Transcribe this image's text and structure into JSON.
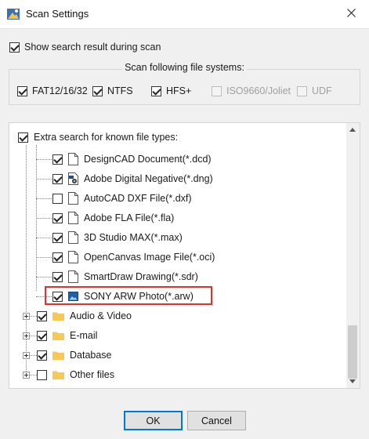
{
  "window": {
    "title": "Scan Settings"
  },
  "options": {
    "show_search_result": {
      "label": "Show search result during scan",
      "checked": true
    }
  },
  "file_systems": {
    "group_label": "Scan following file systems:",
    "items": [
      {
        "label": "FAT12/16/32",
        "checked": true,
        "enabled": true
      },
      {
        "label": "NTFS",
        "checked": true,
        "enabled": true
      },
      {
        "label": "HFS+",
        "checked": true,
        "enabled": true
      },
      {
        "label": "ISO9660/Joliet",
        "checked": false,
        "enabled": false
      },
      {
        "label": "UDF",
        "checked": false,
        "enabled": false
      }
    ]
  },
  "file_types": {
    "root_label": "Extra search for known file types:",
    "root_checked": true,
    "items": [
      {
        "label": "DesignCAD Document(*.dcd)",
        "checked": true,
        "icon": "document-icon"
      },
      {
        "label": "Adobe Digital Negative(*.dng)",
        "checked": true,
        "icon": "dng-file-icon"
      },
      {
        "label": "AutoCAD DXF File(*.dxf)",
        "checked": false,
        "icon": "document-icon"
      },
      {
        "label": "Adobe FLA File(*.fla)",
        "checked": true,
        "icon": "document-icon"
      },
      {
        "label": "3D Studio MAX(*.max)",
        "checked": true,
        "icon": "document-icon"
      },
      {
        "label": "OpenCanvas Image File(*.oci)",
        "checked": true,
        "icon": "document-icon"
      },
      {
        "label": "SmartDraw Drawing(*.sdr)",
        "checked": true,
        "icon": "document-icon"
      },
      {
        "label": "SONY ARW Photo(*.arw)",
        "checked": true,
        "icon": "image-file-icon"
      }
    ],
    "groups": [
      {
        "label": "Audio & Video",
        "checked": true
      },
      {
        "label": "E-mail",
        "checked": true
      },
      {
        "label": "Database",
        "checked": true
      },
      {
        "label": "Other files",
        "checked": false
      }
    ]
  },
  "buttons": {
    "ok": "OK",
    "cancel": "Cancel"
  },
  "colors": {
    "highlight": "#e03030",
    "folder": "#f5c857",
    "default_button_border": "#0078d7"
  }
}
